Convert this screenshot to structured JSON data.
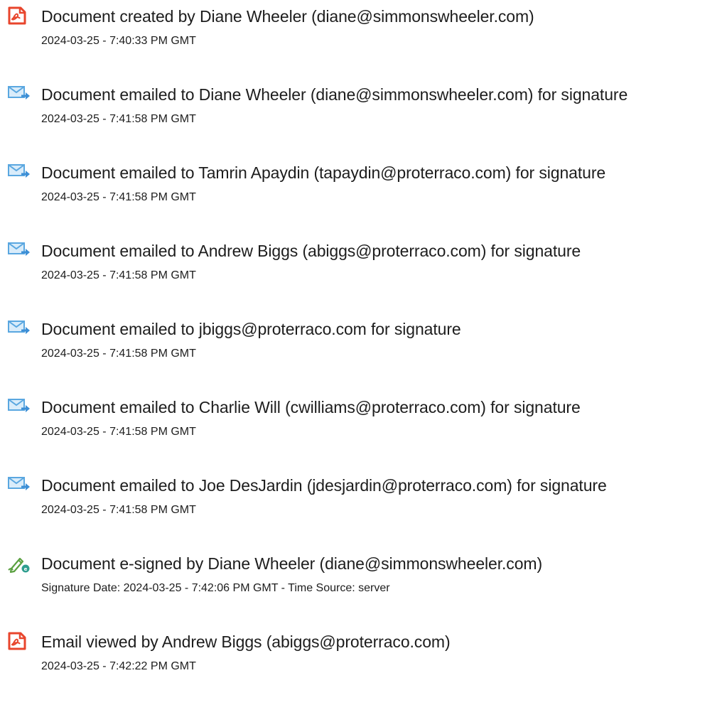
{
  "events": [
    {
      "icon": "document-created-icon",
      "title": "Document created by Diane Wheeler (diane@simmonswheeler.com)",
      "timestamp": "2024-03-25 - 7:40:33 PM GMT"
    },
    {
      "icon": "email-sent-icon",
      "title": "Document emailed to Diane Wheeler (diane@simmonswheeler.com) for signature",
      "timestamp": "2024-03-25 - 7:41:58 PM GMT"
    },
    {
      "icon": "email-sent-icon",
      "title": "Document emailed to Tamrin Apaydin (tapaydin@proterraco.com) for signature",
      "timestamp": "2024-03-25 - 7:41:58 PM GMT"
    },
    {
      "icon": "email-sent-icon",
      "title": "Document emailed to Andrew Biggs (abiggs@proterraco.com) for signature",
      "timestamp": "2024-03-25 - 7:41:58 PM GMT"
    },
    {
      "icon": "email-sent-icon",
      "title": "Document emailed to jbiggs@proterraco.com for signature",
      "timestamp": "2024-03-25 - 7:41:58 PM GMT"
    },
    {
      "icon": "email-sent-icon",
      "title": "Document emailed to Charlie Will (cwilliams@proterraco.com) for signature",
      "timestamp": "2024-03-25 - 7:41:58 PM GMT"
    },
    {
      "icon": "email-sent-icon",
      "title": "Document emailed to Joe DesJardin (jdesjardin@proterraco.com) for signature",
      "timestamp": "2024-03-25 - 7:41:58 PM GMT"
    },
    {
      "icon": "e-signed-icon",
      "title": "Document e-signed by Diane Wheeler (diane@simmonswheeler.com)",
      "timestamp": "Signature Date: 2024-03-25 - 7:42:06 PM GMT - Time Source: server"
    },
    {
      "icon": "document-viewed-icon",
      "title": "Email viewed by Andrew Biggs (abiggs@proterraco.com)",
      "timestamp": "2024-03-25 - 7:42:22 PM GMT"
    }
  ],
  "colors": {
    "document_icon": "#e8452c",
    "email_icon": "#5aa7e0",
    "email_arrow": "#3d8fd6",
    "esign_pen": "#5aa040",
    "esign_badge": "#2f9e8f",
    "text": "#1d1d1d"
  }
}
